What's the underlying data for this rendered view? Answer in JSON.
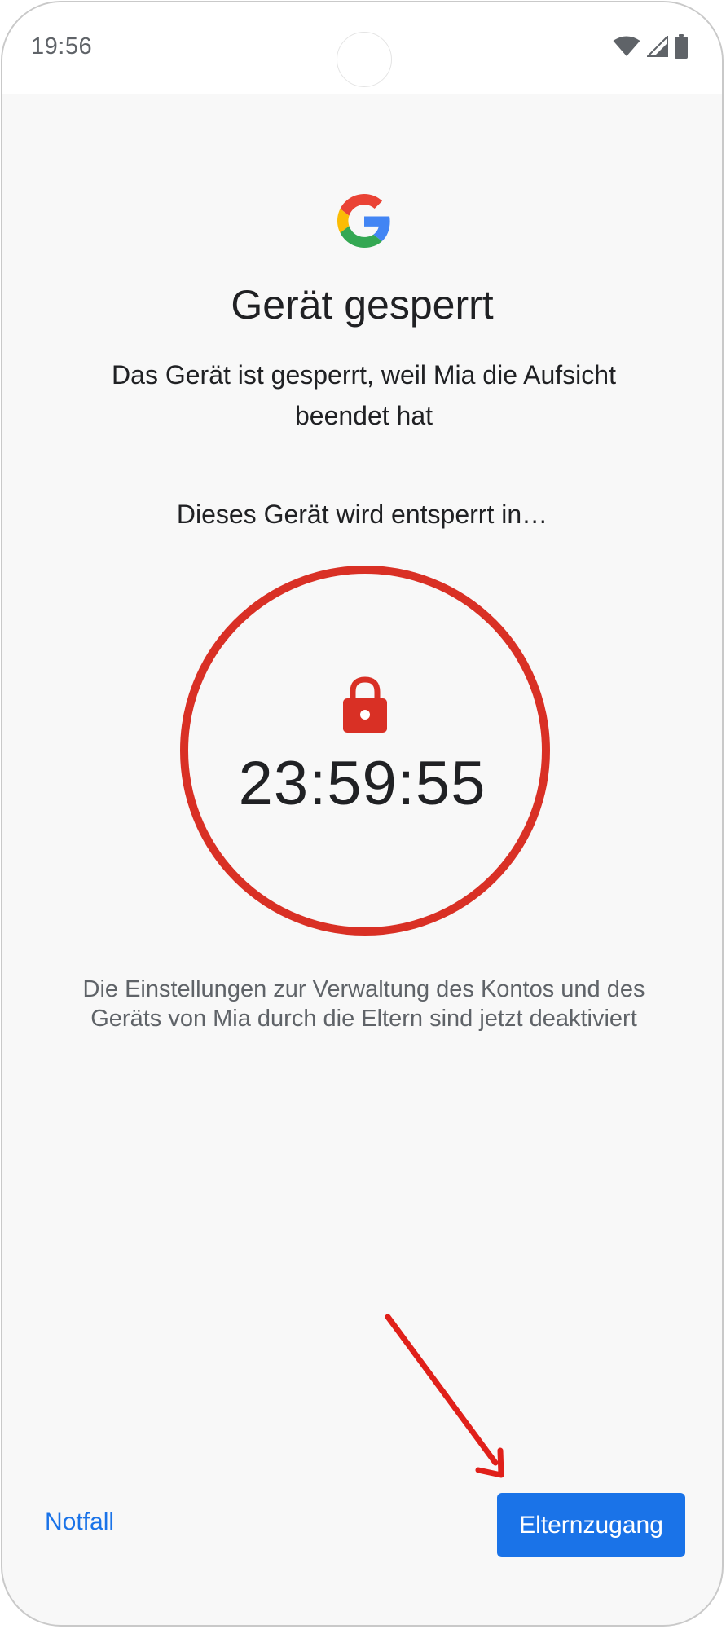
{
  "status_bar": {
    "time": "19:56",
    "icons": [
      "wifi-icon",
      "cell-signal-icon",
      "battery-icon"
    ]
  },
  "header": {
    "logo": "google-g-logo",
    "title": "Gerät gesperrt",
    "subtitle": "Das Gerät ist gesperrt, weil Mia die Aufsicht beendet hat"
  },
  "timer": {
    "label": "Dieses Gerät wird entsperrt in…",
    "icon": "lock-icon",
    "countdown": "23:59:55",
    "ring_color": "#d93025"
  },
  "info": {
    "text": "Die Einstellungen zur Verwaltung des Kontos und des Geräts von Mia durch die Eltern sind jetzt deaktiviert"
  },
  "footer": {
    "emergency_label": "Notfall",
    "parent_access_label": "Elternzugang"
  },
  "colors": {
    "accent": "#1a73e8",
    "alert_red": "#d93025",
    "annotation_arrow": "#e0201a",
    "background": "#f8f8f8"
  }
}
